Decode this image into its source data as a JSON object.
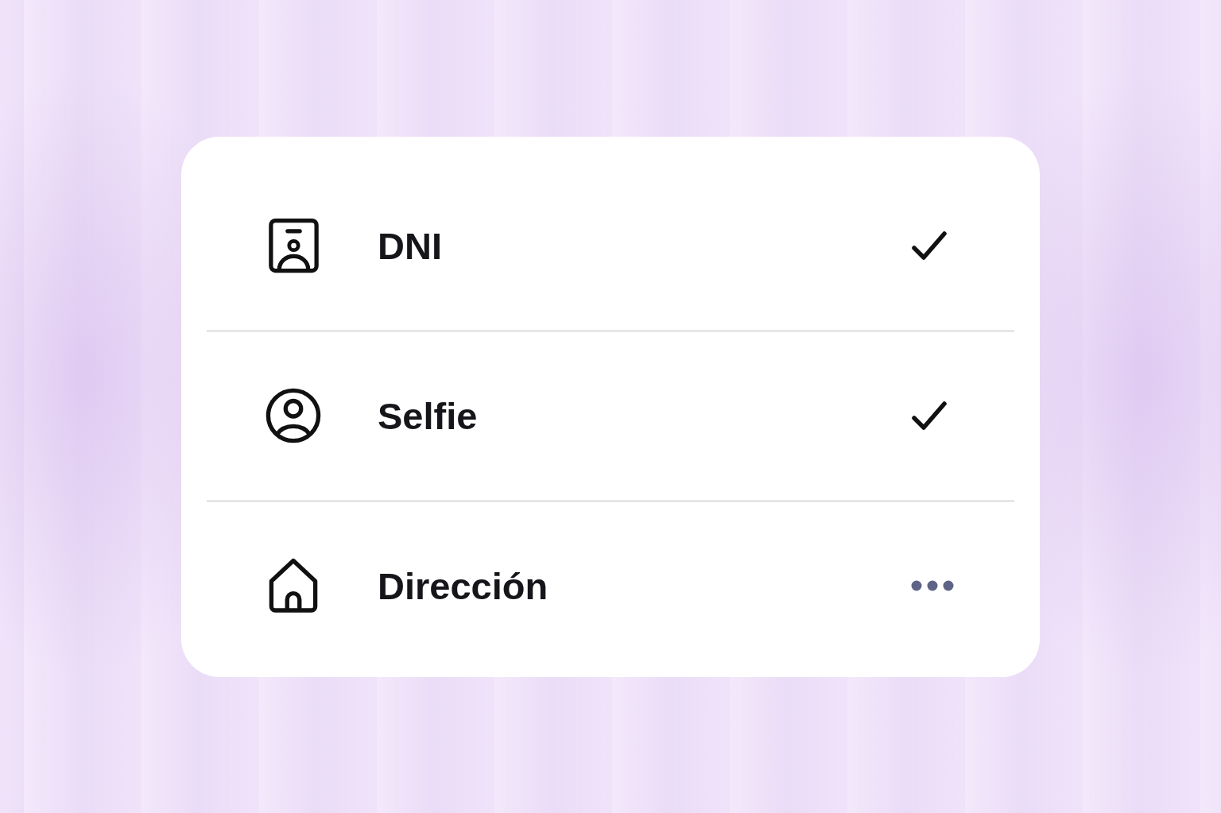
{
  "card": {
    "items": [
      {
        "label": "DNI",
        "completed": true
      },
      {
        "label": "Selfie",
        "completed": true
      },
      {
        "label": "Dirección",
        "completed": false
      }
    ]
  }
}
